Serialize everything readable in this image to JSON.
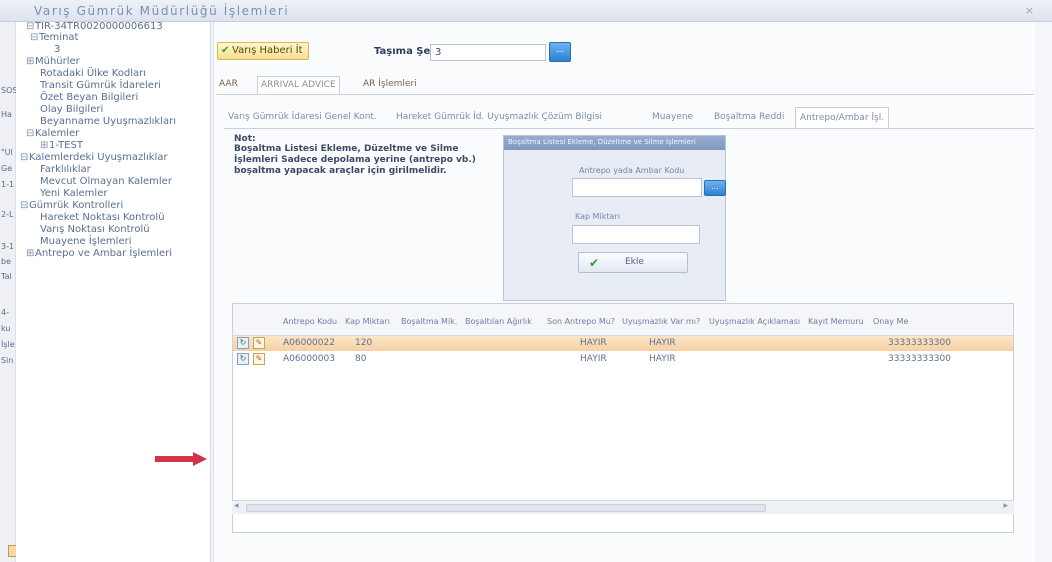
{
  "window": {
    "title": "Varış Gümrük Müdürlüğü İşlemleri",
    "close": "×"
  },
  "left_strip": [
    "SOS",
    "Ha",
    "\"Ul",
    "Ge",
    "1-1",
    "2-L",
    "3-1",
    "be",
    "Tal",
    "4-",
    "ku",
    "İşle",
    "Sin"
  ],
  "tree": [
    {
      "label": "TIR-34TR0020000006613",
      "exp": "⊟"
    },
    {
      "label": "Teminat",
      "exp": "⊟"
    },
    {
      "label": "3",
      "exp": ""
    },
    {
      "label": "Mühürler",
      "exp": "⊞"
    },
    {
      "label": "Rotadaki Ülke Kodları",
      "exp": ""
    },
    {
      "label": "Transit Gümrük İdareleri",
      "exp": ""
    },
    {
      "label": "Özet Beyan Bilgileri",
      "exp": ""
    },
    {
      "label": "Olay Bilgileri",
      "exp": ""
    },
    {
      "label": "Beyanname Uyuşmazlıkları",
      "exp": ""
    },
    {
      "label": "Kalemler",
      "exp": "⊟"
    },
    {
      "label": "1-TEST",
      "exp": "⊞"
    },
    {
      "label": "Kalemlerdeki Uyuşmazlıklar",
      "exp": "⊟"
    },
    {
      "label": "Farklılıklar",
      "exp": ""
    },
    {
      "label": "Mevcut Olmayan Kalemler",
      "exp": ""
    },
    {
      "label": "Yeni Kalemler",
      "exp": ""
    },
    {
      "label": "Gümrük Kontrolleri",
      "exp": "⊟"
    },
    {
      "label": "Hareket Noktası Kontrolü",
      "exp": ""
    },
    {
      "label": "Varış Noktası Kontrolü",
      "exp": ""
    },
    {
      "label": "Muayene İşlemleri",
      "exp": ""
    },
    {
      "label": "Antrepo ve Ambar İşlemleri",
      "exp": "⊞"
    }
  ],
  "toolbar": {
    "send_button": "Varış Haberi İt",
    "tasima_label": "Taşıma Şekli",
    "tasima_value": "3",
    "lookup": "..."
  },
  "outer_tabs": [
    "AAR",
    "ARRIVAL ADVICE",
    "AR İşlemleri"
  ],
  "inner_tabs": [
    "Varış Gümrük İdaresi Genel Kont.",
    "Hareket Gümrük İd. Uyuşmazlık Çözüm Bilgisi",
    "Muayene",
    "Boşaltma Reddi",
    "Antrepo/Ambar İşl."
  ],
  "note": {
    "title": "Not:",
    "text": "Boşaltma Listesi Ekleme, Düzeltme ve Silme İşlemleri Sadece depolama yerine (antrepo vb.) boşaltma yapacak araçlar için girilmelidir."
  },
  "dialog": {
    "title": "Boşaltma Listesi Ekleme, Düzeltme ve Silme İşlemleri",
    "field1_label": "Antrepo yada Ambar Kodu",
    "field2_label": "Kap Miktarı",
    "lookup": "...",
    "add_button": "Ekle"
  },
  "grid": {
    "columns": [
      "Antrepo Kodu",
      "Kap Miktarı",
      "Boşaltma Mik.",
      "Boşaltılan Ağırlık",
      "Son Antrepo Mu?",
      "Uyuşmazlık Var mı?",
      "Uyuşmazlık Açıklaması",
      "Kayıt Memuru",
      "Onay Me"
    ],
    "rows": [
      {
        "kod": "A06000022",
        "kap": "120",
        "son": "HAYIR",
        "uyus": "HAYIR",
        "memur": "33333333300",
        "selected": true
      },
      {
        "kod": "A06000003",
        "kap": "80",
        "son": "HAYIR",
        "uyus": "HAYIR",
        "memur": "33333333300",
        "selected": false
      }
    ]
  },
  "colors": {
    "selected_row": "#f6d0a4",
    "accent_button": "#2d7fd4",
    "annotation_arrow": "#d4334a"
  }
}
